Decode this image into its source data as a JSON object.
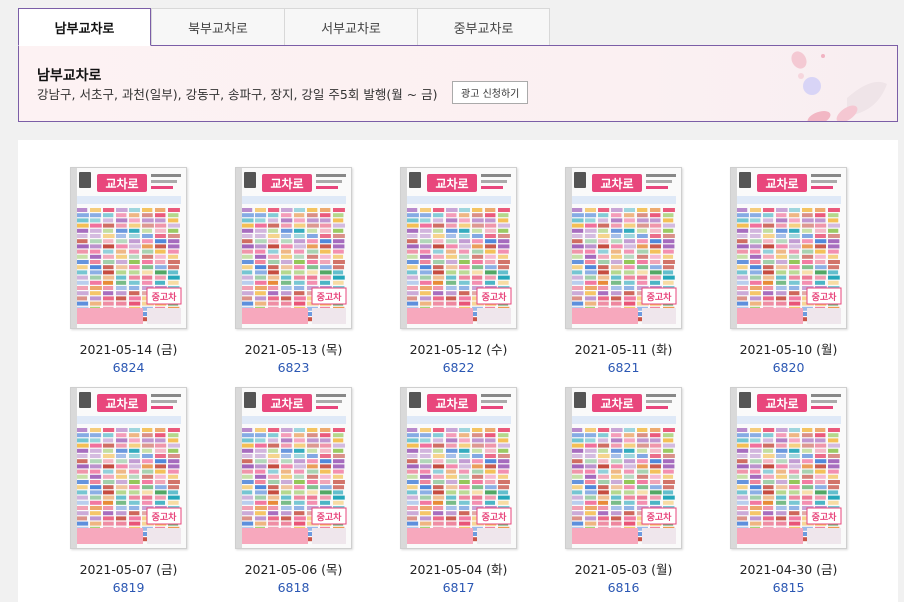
{
  "tabs": [
    {
      "label": "남부교차로",
      "active": true
    },
    {
      "label": "북부교차로",
      "active": false
    },
    {
      "label": "서부교차로",
      "active": false
    },
    {
      "label": "중부교차로",
      "active": false
    }
  ],
  "info": {
    "title": "남부교차로",
    "description": "강남구, 서초구, 과천(일부), 강동구, 송파구, 장지, 강일 주5회 발행(월 ~ 금)",
    "ad_button_label": "광고 신청하기"
  },
  "cover": {
    "logo_text": "교차로",
    "badge_text": "중고차"
  },
  "issues": [
    {
      "date": "2021-05-14 (금)",
      "number": "6824"
    },
    {
      "date": "2021-05-13 (목)",
      "number": "6823"
    },
    {
      "date": "2021-05-12 (수)",
      "number": "6822"
    },
    {
      "date": "2021-05-11 (화)",
      "number": "6821"
    },
    {
      "date": "2021-05-10 (월)",
      "number": "6820"
    },
    {
      "date": "2021-05-07 (금)",
      "number": "6819"
    },
    {
      "date": "2021-05-06 (목)",
      "number": "6818"
    },
    {
      "date": "2021-05-04 (화)",
      "number": "6817"
    },
    {
      "date": "2021-05-03 (월)",
      "number": "6816"
    },
    {
      "date": "2021-04-30 (금)",
      "number": "6815"
    }
  ],
  "colors": {
    "accent_border": "#7b5ea7",
    "link": "#2b57b3",
    "logo_pink": "#e8467c"
  }
}
